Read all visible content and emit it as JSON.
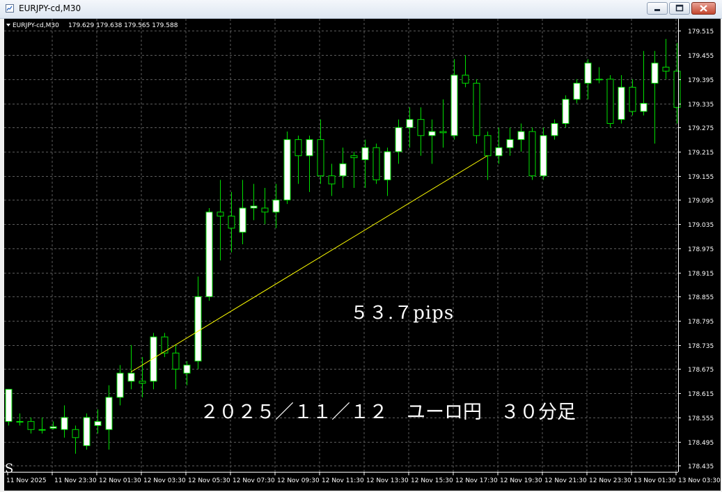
{
  "window": {
    "title": "EURJPY-cd,M30",
    "icons": {
      "app": "chart-window-icon",
      "minimize": "minimize-icon",
      "maximize": "maximize-icon",
      "close": "close-icon"
    }
  },
  "chart_header": {
    "symbol": "EURJPY-cd,M30",
    "ohlc": "179.629 179.638 179.565 179.588",
    "dropdown_icon": "triangle-down-icon"
  },
  "annotations": {
    "pips": "５３.７pips",
    "caption": "２０２５／１１／１２　ユーロ円　３０分足",
    "corner_text": "S"
  },
  "colors": {
    "background": "#000000",
    "bull_body": "#ffffff",
    "bear_body": "#000000",
    "wick": "#00e000",
    "grid": "#5c5c5c",
    "trendline": "#ffff00",
    "text": "#ffffff"
  },
  "chart_data": {
    "type": "candlestick",
    "symbol": "EURJPY-cd",
    "timeframe": "M30",
    "ylim": [
      178.42,
      179.545
    ],
    "y_ticks": [
      "179.515",
      "179.455",
      "179.395",
      "179.335",
      "179.275",
      "179.215",
      "179.155",
      "179.095",
      "179.035",
      "178.975",
      "178.915",
      "178.855",
      "178.795",
      "178.735",
      "178.675",
      "178.615",
      "178.555",
      "178.495",
      "178.435"
    ],
    "x_labels": [
      "11 Nov 2025",
      "11 Nov 23:30",
      "12 Nov 01:30",
      "12 Nov 03:30",
      "12 Nov 05:30",
      "12 Nov 07:30",
      "12 Nov 09:30",
      "12 Nov 11:30",
      "12 Nov 13:30",
      "12 Nov 15:30",
      "12 Nov 17:30",
      "12 Nov 19:30",
      "12 Nov 21:30",
      "12 Nov 23:30",
      "13 Nov 01:30",
      "13 Nov 03:30"
    ],
    "candles": [
      {
        "o": 178.545,
        "h": 178.625,
        "l": 178.535,
        "c": 178.625
      },
      {
        "o": 178.545,
        "h": 178.565,
        "l": 178.535,
        "c": 178.545
      },
      {
        "o": 178.545,
        "h": 178.555,
        "l": 178.515,
        "c": 178.525
      },
      {
        "o": 178.525,
        "h": 178.555,
        "l": 178.515,
        "c": 178.525
      },
      {
        "o": 178.528,
        "h": 178.545,
        "l": 178.525,
        "c": 178.532
      },
      {
        "o": 178.525,
        "h": 178.585,
        "l": 178.505,
        "c": 178.555
      },
      {
        "o": 178.525,
        "h": 178.535,
        "l": 178.465,
        "c": 178.505
      },
      {
        "o": 178.485,
        "h": 178.565,
        "l": 178.475,
        "c": 178.555
      },
      {
        "o": 178.535,
        "h": 178.575,
        "l": 178.515,
        "c": 178.545
      },
      {
        "o": 178.525,
        "h": 178.635,
        "l": 178.475,
        "c": 178.605
      },
      {
        "o": 178.605,
        "h": 178.685,
        "l": 178.585,
        "c": 178.665
      },
      {
        "o": 178.645,
        "h": 178.735,
        "l": 178.625,
        "c": 178.665
      },
      {
        "o": 178.645,
        "h": 178.705,
        "l": 178.605,
        "c": 178.64
      },
      {
        "o": 178.645,
        "h": 178.765,
        "l": 178.625,
        "c": 178.755
      },
      {
        "o": 178.755,
        "h": 178.765,
        "l": 178.705,
        "c": 178.715
      },
      {
        "o": 178.715,
        "h": 178.735,
        "l": 178.625,
        "c": 178.675
      },
      {
        "o": 178.665,
        "h": 178.695,
        "l": 178.635,
        "c": 178.685
      },
      {
        "o": 178.695,
        "h": 178.905,
        "l": 178.675,
        "c": 178.855
      },
      {
        "o": 178.855,
        "h": 179.075,
        "l": 178.845,
        "c": 179.065
      },
      {
        "o": 179.065,
        "h": 179.145,
        "l": 178.945,
        "c": 179.055
      },
      {
        "o": 179.055,
        "h": 179.115,
        "l": 178.965,
        "c": 179.025
      },
      {
        "o": 179.015,
        "h": 179.145,
        "l": 178.985,
        "c": 179.075
      },
      {
        "o": 179.075,
        "h": 179.135,
        "l": 179.045,
        "c": 179.08
      },
      {
        "o": 179.075,
        "h": 179.125,
        "l": 179.035,
        "c": 179.065
      },
      {
        "o": 179.065,
        "h": 179.135,
        "l": 179.025,
        "c": 179.095
      },
      {
        "o": 179.095,
        "h": 179.265,
        "l": 179.085,
        "c": 179.245
      },
      {
        "o": 179.245,
        "h": 179.255,
        "l": 179.135,
        "c": 179.205
      },
      {
        "o": 179.205,
        "h": 179.255,
        "l": 179.115,
        "c": 179.245
      },
      {
        "o": 179.245,
        "h": 179.295,
        "l": 179.135,
        "c": 179.155
      },
      {
        "o": 179.155,
        "h": 179.185,
        "l": 179.105,
        "c": 179.135
      },
      {
        "o": 179.155,
        "h": 179.225,
        "l": 179.125,
        "c": 179.185
      },
      {
        "o": 179.205,
        "h": 179.215,
        "l": 179.125,
        "c": 179.2
      },
      {
        "o": 179.195,
        "h": 179.245,
        "l": 179.125,
        "c": 179.225
      },
      {
        "o": 179.225,
        "h": 179.235,
        "l": 179.135,
        "c": 179.145
      },
      {
        "o": 179.145,
        "h": 179.225,
        "l": 179.105,
        "c": 179.215
      },
      {
        "o": 179.215,
        "h": 179.295,
        "l": 179.185,
        "c": 179.275
      },
      {
        "o": 179.275,
        "h": 179.325,
        "l": 179.225,
        "c": 179.295
      },
      {
        "o": 179.295,
        "h": 179.325,
        "l": 179.205,
        "c": 179.255
      },
      {
        "o": 179.255,
        "h": 179.295,
        "l": 179.185,
        "c": 179.265
      },
      {
        "o": 179.265,
        "h": 179.345,
        "l": 179.225,
        "c": 179.262
      },
      {
        "o": 179.255,
        "h": 179.445,
        "l": 179.245,
        "c": 179.405
      },
      {
        "o": 179.405,
        "h": 179.455,
        "l": 179.375,
        "c": 179.385
      },
      {
        "o": 179.385,
        "h": 179.395,
        "l": 179.235,
        "c": 179.255
      },
      {
        "o": 179.255,
        "h": 179.265,
        "l": 179.145,
        "c": 179.205
      },
      {
        "o": 179.205,
        "h": 179.275,
        "l": 179.185,
        "c": 179.225
      },
      {
        "o": 179.225,
        "h": 179.275,
        "l": 179.205,
        "c": 179.245
      },
      {
        "o": 179.245,
        "h": 179.285,
        "l": 179.215,
        "c": 179.265
      },
      {
        "o": 179.265,
        "h": 179.275,
        "l": 179.145,
        "c": 179.155
      },
      {
        "o": 179.155,
        "h": 179.275,
        "l": 179.145,
        "c": 179.255
      },
      {
        "o": 179.255,
        "h": 179.295,
        "l": 179.245,
        "c": 179.285
      },
      {
        "o": 179.285,
        "h": 179.355,
        "l": 179.275,
        "c": 179.345
      },
      {
        "o": 179.345,
        "h": 179.395,
        "l": 179.335,
        "c": 179.385
      },
      {
        "o": 179.385,
        "h": 179.445,
        "l": 179.345,
        "c": 179.435
      },
      {
        "o": 179.395,
        "h": 179.425,
        "l": 179.385,
        "c": 179.395
      },
      {
        "o": 179.395,
        "h": 179.405,
        "l": 179.275,
        "c": 179.285
      },
      {
        "o": 179.295,
        "h": 179.405,
        "l": 179.285,
        "c": 179.375
      },
      {
        "o": 179.375,
        "h": 179.395,
        "l": 179.305,
        "c": 179.315
      },
      {
        "o": 179.315,
        "h": 179.465,
        "l": 179.305,
        "c": 179.335
      },
      {
        "o": 179.385,
        "h": 179.465,
        "l": 179.235,
        "c": 179.435
      },
      {
        "o": 179.425,
        "h": 179.495,
        "l": 179.395,
        "c": 179.415
      },
      {
        "o": 179.415,
        "h": 179.485,
        "l": 179.285,
        "c": 179.325
      }
    ],
    "trendline": {
      "from": {
        "index": 11,
        "price": 178.668
      },
      "to": {
        "index": 43,
        "price": 179.205
      }
    }
  }
}
